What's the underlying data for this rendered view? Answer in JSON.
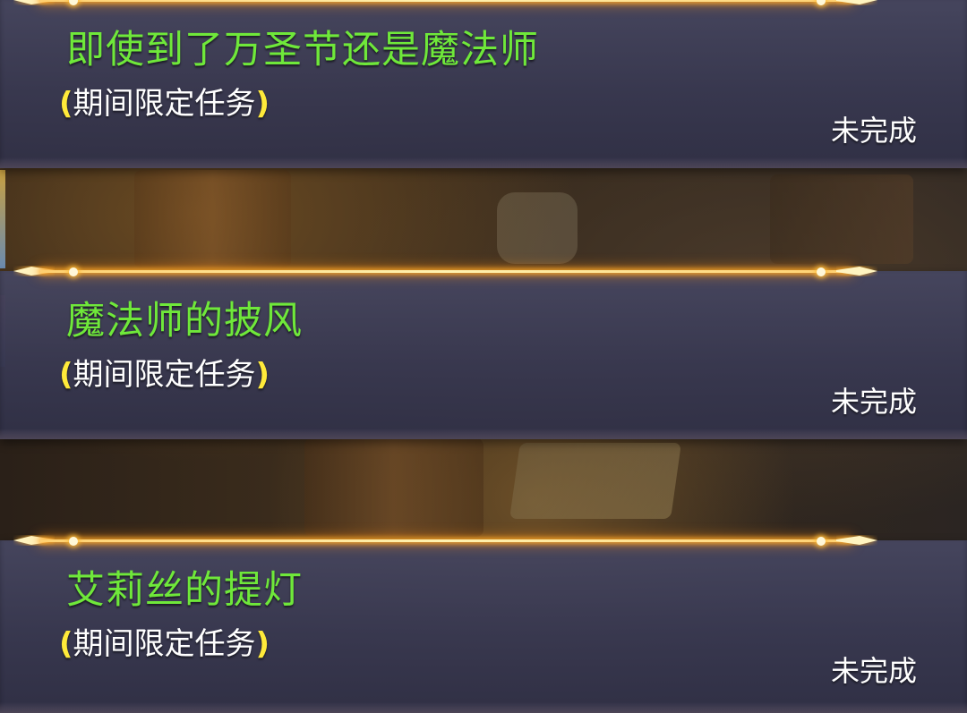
{
  "quests": [
    {
      "title": "即使到了万圣节还是魔法师",
      "subtitle_open": "(",
      "subtitle_text": "期间限定任务",
      "subtitle_close": ")",
      "status": "未完成"
    },
    {
      "title": "魔法师的披风",
      "subtitle_open": "(",
      "subtitle_text": "期间限定任务",
      "subtitle_close": ")",
      "status": "未完成"
    },
    {
      "title": "艾莉丝的提灯",
      "subtitle_open": "(",
      "subtitle_text": "期间限定任务",
      "subtitle_close": ")",
      "status": "未完成"
    }
  ],
  "colors": {
    "title": "#6fe83a",
    "paren": "#ffea3a",
    "text": "#ffffff",
    "divider_glow": "#ffb030"
  }
}
